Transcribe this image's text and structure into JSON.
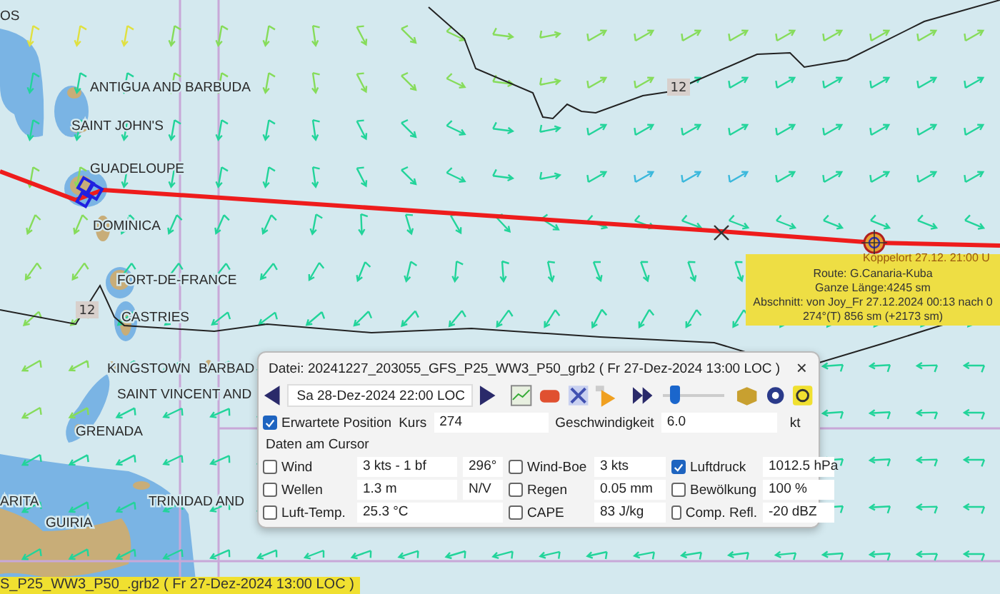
{
  "map": {
    "place_labels": [
      "OS",
      "ANTIGUA AND BARBUDA",
      "SAINT JOHN'S",
      "GUADELOUPE",
      "DOMINICA",
      "FORT-DE-FRANCE",
      "CASTRIES",
      "KINGSTOWN",
      "BARBAD",
      "SAINT VINCENT AND",
      "GRENADA",
      "ARITA",
      "GUIRIA",
      "TRINIDAD AND"
    ],
    "contour_labels": [
      "12",
      "12"
    ],
    "position_label": "Koppelort 27.12. 21:00 U"
  },
  "route_tooltip": {
    "lines": [
      "Route: G.Canaria-Kuba",
      "Ganze Länge:4245 sm",
      "Abschnitt: von Joy_Fr 27.12.2024 00:13 nach 0",
      "274°(T) 856 sm (+2173 sm)"
    ]
  },
  "status_bar": {
    "text": "S_P25_WW3_P50_.grb2 ( Fr 27-Dez-2024  13:00 LOC )"
  },
  "dialog": {
    "title": "Datei: 20241227_203055_GFS_P25_WW3_P50_grb2 ( Fr 27-Dez-2024  13:00 LOC )",
    "close": "×",
    "date_select": "Sa 28-Dez-2024  22:00 LOC",
    "time_slider": {
      "level": 0.2
    },
    "expected_position": {
      "label": "Erwartete Position",
      "checked": true
    },
    "course": {
      "label": "Kurs",
      "value": "274"
    },
    "speed": {
      "label": "Geschwindigkeit",
      "value": "6.0",
      "unit": "kt"
    },
    "section": "Daten am Cursor",
    "data": [
      {
        "label": "Wind",
        "checked": false,
        "value": "3 kts -  1 bf",
        "extra": "296°"
      },
      {
        "label": "Wind-Boe",
        "checked": false,
        "value": "3 kts"
      },
      {
        "label": "Luftdruck",
        "checked": true,
        "value": "1012.5 hPa"
      },
      {
        "label": "Wellen",
        "checked": false,
        "value": "1.3 m",
        "extra": "N/V"
      },
      {
        "label": "Regen",
        "checked": false,
        "value": "0.05 mm"
      },
      {
        "label": "Bewölkung",
        "checked": false,
        "value": "100 %"
      },
      {
        "label": "Luft-Temp.",
        "checked": false,
        "value": "25.3 °C"
      },
      {
        "label": "CAPE",
        "checked": false,
        "value": "83 J/kg"
      },
      {
        "label": "Comp. Refl.",
        "checked": false,
        "value": "-20 dBZ"
      }
    ]
  }
}
